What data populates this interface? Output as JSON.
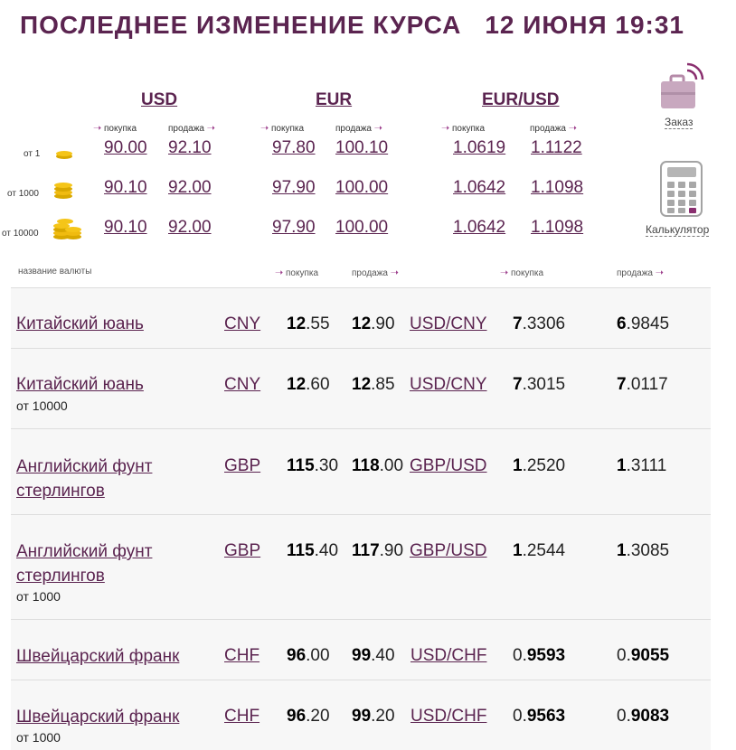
{
  "header": {
    "title": "ПОСЛЕДНЕЕ ИЗМЕНЕНИЕ КУРСА",
    "date": "12 ИЮНЯ 19:31"
  },
  "top": {
    "currencies": [
      "USD",
      "EUR",
      "EUR/USD"
    ],
    "buy_label": "покупка",
    "sell_label": "продажа",
    "tiers": [
      {
        "label": "от 1",
        "usd_buy": "90.00",
        "usd_sell": "92.10",
        "eur_buy": "97.80",
        "eur_sell": "100.10",
        "eurusd_buy": "1.0619",
        "eurusd_sell": "1.1122"
      },
      {
        "label": "от 1000",
        "usd_buy": "90.10",
        "usd_sell": "92.00",
        "eur_buy": "97.90",
        "eur_sell": "100.00",
        "eurusd_buy": "1.0642",
        "eurusd_sell": "1.1098"
      },
      {
        "label": "от 10000",
        "usd_buy": "90.10",
        "usd_sell": "92.00",
        "eur_buy": "97.90",
        "eur_sell": "100.00",
        "eurusd_buy": "1.0642",
        "eurusd_sell": "1.1098"
      }
    ]
  },
  "side": {
    "order_label": "Заказ",
    "calc_label": "Калькулятор"
  },
  "table": {
    "headers": {
      "name": "название валюты",
      "buy": "покупка",
      "sell": "продажа",
      "cross_buy": "покупка",
      "cross_sell": "продажа"
    },
    "rows": [
      {
        "name": "Китайский юань",
        "note": "",
        "code": "CNY",
        "buy_b": "12",
        "buy_r": ".55",
        "sell_b": "12",
        "sell_r": ".90",
        "pair": "USD/CNY",
        "cb_a": "",
        "cb_b": "7",
        "cb_c": ".3306",
        "cs_a": "",
        "cs_b": "6",
        "cs_c": ".9845"
      },
      {
        "name": "Китайский юань",
        "note": "от 10000",
        "code": "CNY",
        "buy_b": "12",
        "buy_r": ".60",
        "sell_b": "12",
        "sell_r": ".85",
        "pair": "USD/CNY",
        "cb_a": "",
        "cb_b": "7",
        "cb_c": ".3015",
        "cs_a": "",
        "cs_b": "7",
        "cs_c": ".0117"
      },
      {
        "name": "Английский фунт стерлингов",
        "note": "",
        "code": "GBP",
        "buy_b": "115",
        "buy_r": ".30",
        "sell_b": "118",
        "sell_r": ".00",
        "pair": "GBP/USD",
        "cb_a": "",
        "cb_b": "1",
        "cb_c": ".2520",
        "cs_a": "",
        "cs_b": "1",
        "cs_c": ".3111"
      },
      {
        "name": "Английский фунт стерлингов",
        "note": "от 1000",
        "code": "GBP",
        "buy_b": "115",
        "buy_r": ".40",
        "sell_b": "117",
        "sell_r": ".90",
        "pair": "GBP/USD",
        "cb_a": "",
        "cb_b": "1",
        "cb_c": ".2544",
        "cs_a": "",
        "cs_b": "1",
        "cs_c": ".3085"
      },
      {
        "name": "Швейцарский франк",
        "note": "",
        "code": "CHF",
        "buy_b": "96",
        "buy_r": ".00",
        "sell_b": "99",
        "sell_r": ".40",
        "pair": "USD/CHF",
        "cb_a": "0.",
        "cb_b": "9593",
        "cb_c": "",
        "cs_a": "0.",
        "cs_b": "9055",
        "cs_c": ""
      },
      {
        "name": "Швейцарский франк",
        "note": "от 1000",
        "code": "CHF",
        "buy_b": "96",
        "buy_r": ".20",
        "sell_b": "99",
        "sell_r": ".20",
        "pair": "USD/CHF",
        "cb_a": "0.",
        "cb_b": "9563",
        "cb_c": "",
        "cs_a": "0.",
        "cs_b": "9083",
        "cs_c": ""
      }
    ]
  }
}
